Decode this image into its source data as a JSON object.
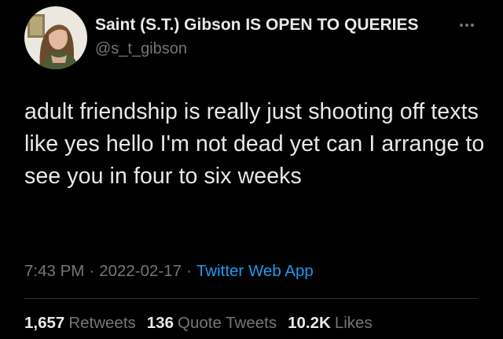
{
  "colors": {
    "background": "#000000",
    "primary_text": "#e7e9ea",
    "secondary_text": "#71767b",
    "link": "#1d9bf0",
    "divider": "#2f3336"
  },
  "author": {
    "display_name": "Saint (S.T.) Gibson IS OPEN TO QUERIES",
    "handle": "@s_t_gibson",
    "avatar_icon": "profile-photo"
  },
  "more_icon": "more-horizontal-icon",
  "tweet": {
    "text": "adult friendship is really just shooting off texts like yes hello I'm not dead yet can I arrange to see you in four to six weeks",
    "time": "7:43 PM",
    "separator": "·",
    "date": "2022-02-17",
    "source": "Twitter Web App"
  },
  "stats": {
    "retweets_count": "1,657",
    "retweets_label": "Retweets",
    "quotes_count": "136",
    "quotes_label": "Quote Tweets",
    "likes_count": "10.2K",
    "likes_label": "Likes"
  }
}
